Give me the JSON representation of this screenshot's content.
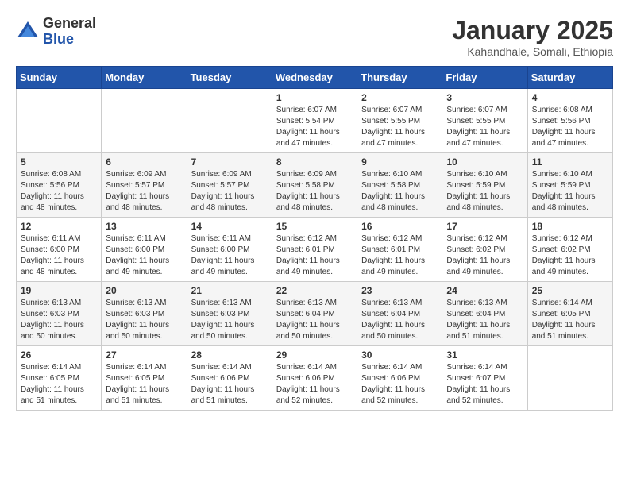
{
  "header": {
    "logo_general": "General",
    "logo_blue": "Blue",
    "month_year": "January 2025",
    "location": "Kahandhale, Somali, Ethiopia"
  },
  "weekdays": [
    "Sunday",
    "Monday",
    "Tuesday",
    "Wednesday",
    "Thursday",
    "Friday",
    "Saturday"
  ],
  "weeks": [
    [
      {
        "day": "",
        "info": ""
      },
      {
        "day": "",
        "info": ""
      },
      {
        "day": "",
        "info": ""
      },
      {
        "day": "1",
        "info": "Sunrise: 6:07 AM\nSunset: 5:54 PM\nDaylight: 11 hours\nand 47 minutes."
      },
      {
        "day": "2",
        "info": "Sunrise: 6:07 AM\nSunset: 5:55 PM\nDaylight: 11 hours\nand 47 minutes."
      },
      {
        "day": "3",
        "info": "Sunrise: 6:07 AM\nSunset: 5:55 PM\nDaylight: 11 hours\nand 47 minutes."
      },
      {
        "day": "4",
        "info": "Sunrise: 6:08 AM\nSunset: 5:56 PM\nDaylight: 11 hours\nand 47 minutes."
      }
    ],
    [
      {
        "day": "5",
        "info": "Sunrise: 6:08 AM\nSunset: 5:56 PM\nDaylight: 11 hours\nand 48 minutes."
      },
      {
        "day": "6",
        "info": "Sunrise: 6:09 AM\nSunset: 5:57 PM\nDaylight: 11 hours\nand 48 minutes."
      },
      {
        "day": "7",
        "info": "Sunrise: 6:09 AM\nSunset: 5:57 PM\nDaylight: 11 hours\nand 48 minutes."
      },
      {
        "day": "8",
        "info": "Sunrise: 6:09 AM\nSunset: 5:58 PM\nDaylight: 11 hours\nand 48 minutes."
      },
      {
        "day": "9",
        "info": "Sunrise: 6:10 AM\nSunset: 5:58 PM\nDaylight: 11 hours\nand 48 minutes."
      },
      {
        "day": "10",
        "info": "Sunrise: 6:10 AM\nSunset: 5:59 PM\nDaylight: 11 hours\nand 48 minutes."
      },
      {
        "day": "11",
        "info": "Sunrise: 6:10 AM\nSunset: 5:59 PM\nDaylight: 11 hours\nand 48 minutes."
      }
    ],
    [
      {
        "day": "12",
        "info": "Sunrise: 6:11 AM\nSunset: 6:00 PM\nDaylight: 11 hours\nand 48 minutes."
      },
      {
        "day": "13",
        "info": "Sunrise: 6:11 AM\nSunset: 6:00 PM\nDaylight: 11 hours\nand 49 minutes."
      },
      {
        "day": "14",
        "info": "Sunrise: 6:11 AM\nSunset: 6:00 PM\nDaylight: 11 hours\nand 49 minutes."
      },
      {
        "day": "15",
        "info": "Sunrise: 6:12 AM\nSunset: 6:01 PM\nDaylight: 11 hours\nand 49 minutes."
      },
      {
        "day": "16",
        "info": "Sunrise: 6:12 AM\nSunset: 6:01 PM\nDaylight: 11 hours\nand 49 minutes."
      },
      {
        "day": "17",
        "info": "Sunrise: 6:12 AM\nSunset: 6:02 PM\nDaylight: 11 hours\nand 49 minutes."
      },
      {
        "day": "18",
        "info": "Sunrise: 6:12 AM\nSunset: 6:02 PM\nDaylight: 11 hours\nand 49 minutes."
      }
    ],
    [
      {
        "day": "19",
        "info": "Sunrise: 6:13 AM\nSunset: 6:03 PM\nDaylight: 11 hours\nand 50 minutes."
      },
      {
        "day": "20",
        "info": "Sunrise: 6:13 AM\nSunset: 6:03 PM\nDaylight: 11 hours\nand 50 minutes."
      },
      {
        "day": "21",
        "info": "Sunrise: 6:13 AM\nSunset: 6:03 PM\nDaylight: 11 hours\nand 50 minutes."
      },
      {
        "day": "22",
        "info": "Sunrise: 6:13 AM\nSunset: 6:04 PM\nDaylight: 11 hours\nand 50 minutes."
      },
      {
        "day": "23",
        "info": "Sunrise: 6:13 AM\nSunset: 6:04 PM\nDaylight: 11 hours\nand 50 minutes."
      },
      {
        "day": "24",
        "info": "Sunrise: 6:13 AM\nSunset: 6:04 PM\nDaylight: 11 hours\nand 51 minutes."
      },
      {
        "day": "25",
        "info": "Sunrise: 6:14 AM\nSunset: 6:05 PM\nDaylight: 11 hours\nand 51 minutes."
      }
    ],
    [
      {
        "day": "26",
        "info": "Sunrise: 6:14 AM\nSunset: 6:05 PM\nDaylight: 11 hours\nand 51 minutes."
      },
      {
        "day": "27",
        "info": "Sunrise: 6:14 AM\nSunset: 6:05 PM\nDaylight: 11 hours\nand 51 minutes."
      },
      {
        "day": "28",
        "info": "Sunrise: 6:14 AM\nSunset: 6:06 PM\nDaylight: 11 hours\nand 51 minutes."
      },
      {
        "day": "29",
        "info": "Sunrise: 6:14 AM\nSunset: 6:06 PM\nDaylight: 11 hours\nand 52 minutes."
      },
      {
        "day": "30",
        "info": "Sunrise: 6:14 AM\nSunset: 6:06 PM\nDaylight: 11 hours\nand 52 minutes."
      },
      {
        "day": "31",
        "info": "Sunrise: 6:14 AM\nSunset: 6:07 PM\nDaylight: 11 hours\nand 52 minutes."
      },
      {
        "day": "",
        "info": ""
      }
    ]
  ]
}
